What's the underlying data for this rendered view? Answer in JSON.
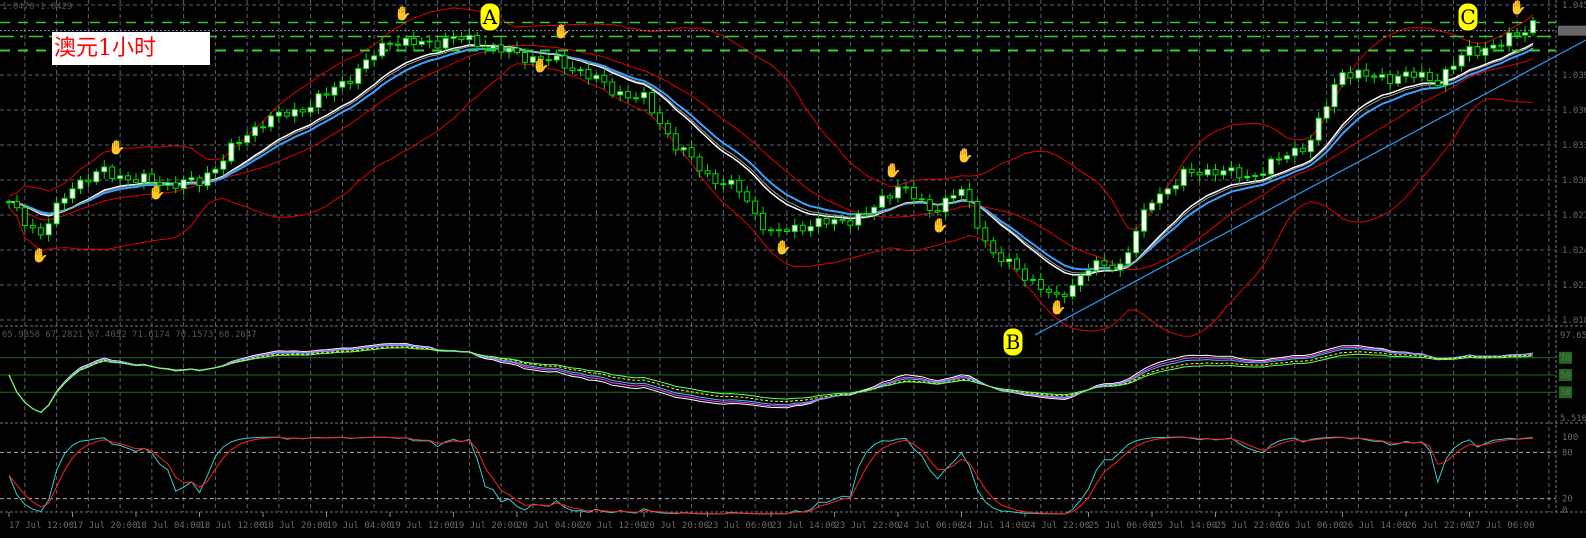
{
  "header": {
    "symbol_info": "1.0478 1.0429"
  },
  "title_box": {
    "text": "澳元1小时"
  },
  "annotations": {
    "a": "A",
    "b": "B",
    "c": "C"
  },
  "colors": {
    "background": "#000000",
    "grid": "#5a6470",
    "bull_body": "#ffffff",
    "candle_outline": "#00e000",
    "bollinger": "#e00000",
    "ma_white": "#ffffff",
    "ma_blue": "#3aa0ff",
    "trendline": "#2a9df4",
    "level_green": "#33cc33",
    "stoch_k": "#33cccc",
    "stoch_d": "#ff2020",
    "label_yellow": "#ffff00"
  },
  "chart_data": [
    {
      "type": "candlestick",
      "title": "",
      "price_axis": [
        "1.045",
        "1.039",
        "1.036",
        "1.033",
        "1.030",
        "1.027",
        "1.024",
        "1.021",
        "1.018"
      ],
      "price_ticks": [
        1.045,
        1.039,
        1.036,
        1.033,
        1.03,
        1.027,
        1.024,
        1.021,
        1.018
      ],
      "time_axis": [
        "17 Jul 12:00",
        "17 Jul 20:00",
        "18 Jul 04:00",
        "18 Jul 12:00",
        "18 Jul 20:00",
        "19 Jul 04:00",
        "19 Jul 12:00",
        "19 Jul 20:00",
        "20 Jul 04:00",
        "20 Jul 12:00",
        "20 Jul 20:00",
        "23 Jul 06:00",
        "23 Jul 14:00",
        "23 Jul 22:00",
        "24 Jul 06:00",
        "24 Jul 14:00",
        "24 Jul 22:00",
        "25 Jul 06:00",
        "25 Jul 14:00",
        "25 Jul 22:00",
        "26 Jul 06:00",
        "26 Jul 14:00",
        "26 Jul 22:00",
        "27 Jul 06:00"
      ],
      "close_path": [
        1.0279,
        1.0253,
        1.0296,
        1.0307,
        1.03,
        1.0297,
        1.0298,
        1.0326,
        1.0351,
        1.0358,
        1.0373,
        1.0394,
        1.042,
        1.0416,
        1.0422,
        1.0416,
        1.0407,
        1.0403,
        1.0394,
        1.0377,
        1.0369,
        1.033,
        1.0304,
        1.0291,
        1.0253,
        1.0261,
        1.0264,
        1.027,
        1.0296,
        1.0274,
        1.0291,
        1.0236,
        1.0219,
        1.0197,
        1.0225,
        1.0227,
        1.0283,
        1.0304,
        1.0309,
        1.0302,
        1.0317,
        1.0334,
        1.0394,
        1.0387,
        1.039,
        1.0386,
        1.0411,
        1.0416,
        1.0435
      ],
      "horizontal_levels": [
        1.0435,
        1.0423,
        1.0411
      ],
      "current_price": 1.0428
    },
    {
      "type": "line",
      "header": "65.9058 67.2821 67.4052 71.6174 70.1573 68.2647",
      "axis_labels": [
        "97.658",
        "70",
        "50",
        "30",
        "5.5165"
      ],
      "levels": [
        70,
        50,
        30
      ]
    },
    {
      "type": "line",
      "axis_labels": [
        "100",
        "80",
        "20",
        "0"
      ],
      "levels": [
        80,
        20
      ],
      "series": [
        {
          "color": "#33cccc"
        },
        {
          "color": "#ff2020"
        }
      ]
    }
  ]
}
